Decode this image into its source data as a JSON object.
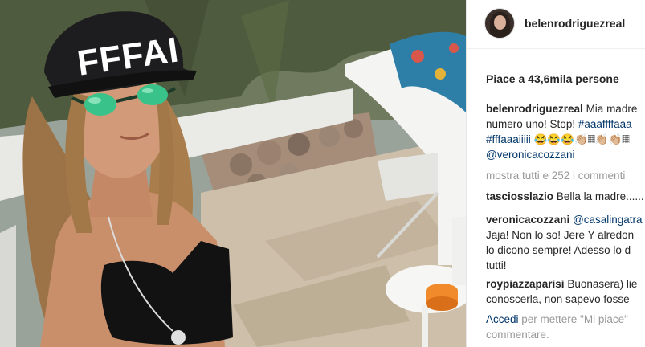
{
  "post": {
    "hat_text": "FFFAI"
  },
  "header": {
    "username": "belenrodriguezreal"
  },
  "likes": {
    "text": "Piace a 43,6mila persone"
  },
  "caption": {
    "author": "belenrodriguezreal",
    "line1": "Mia madre",
    "line2_text": "numero uno! Stop! ",
    "line2_tag": "#aaaffffaaa",
    "line3_tag": "#fffaaaiiiii",
    "line3_emoji": " 😂😂😂👏🏼𝄜👏🏼👏🏼𝄜",
    "line4_mention": "@veronicacozzani"
  },
  "show_all": {
    "text": "mostra tutti e 252 i commenti"
  },
  "comments": [
    {
      "author": "tasciosslazio",
      "text": "Bella la madre......"
    },
    {
      "author": "veronicacozzani",
      "mention": "@casalingatra",
      "lines": [
        "Jaja! Non lo so! Jere Y alredon",
        "lo dicono sempre! Adesso lo d",
        "tutti!"
      ]
    },
    {
      "author": "roypiazzaparisi",
      "text": "Buonasera) lie",
      "line2": "conoscerla, non sapevo fosse"
    }
  ],
  "footer": {
    "login_link": "Accedi",
    "rest": " per mettere \"Mi piace\"",
    "line2": "commentare."
  }
}
